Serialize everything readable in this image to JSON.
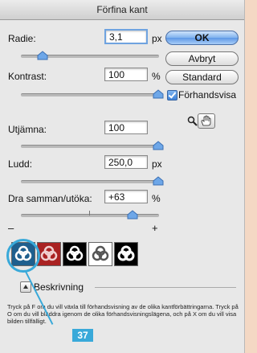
{
  "dialog": {
    "title": "Förfina kant"
  },
  "controls": {
    "radius": {
      "label": "Radie:",
      "value": "3,1",
      "unit": "px"
    },
    "contrast": {
      "label": "Kontrast:",
      "value": "100",
      "unit": "%"
    },
    "smooth": {
      "label": "Utjämna:",
      "value": "100"
    },
    "feather": {
      "label": "Ludd:",
      "value": "250,0",
      "unit": "px"
    },
    "contract": {
      "label": "Dra samman/utöka:",
      "value": "+63",
      "unit": "%",
      "min_label": "–",
      "max_label": "+"
    }
  },
  "buttons": {
    "ok": "OK",
    "cancel": "Avbryt",
    "default": "Standard"
  },
  "preview_checkbox": {
    "label": "Förhandsvisa",
    "checked": true
  },
  "tools": {
    "zoom": "zoom-icon",
    "hand": "hand-icon"
  },
  "preview_modes": [
    {
      "name": "standard",
      "bg": "#1e5f8e"
    },
    {
      "name": "quick-mask",
      "bg": "#a92222"
    },
    {
      "name": "on-black",
      "bg": "#000000"
    },
    {
      "name": "on-white",
      "bg": "#ffffff"
    },
    {
      "name": "mask",
      "bg": "#000000"
    }
  ],
  "description": {
    "toggle_label": "Beskrivning",
    "text": "Tryck på F om du vill växla till förhandsvisning av de olika kantförbättringarna. Tryck på O om du vill bläddra igenom de olika förhandsvisningslägena, och på X om du vill visa bilden tillfälligt."
  },
  "callout": {
    "number": "37",
    "color": "#39a9d9"
  }
}
